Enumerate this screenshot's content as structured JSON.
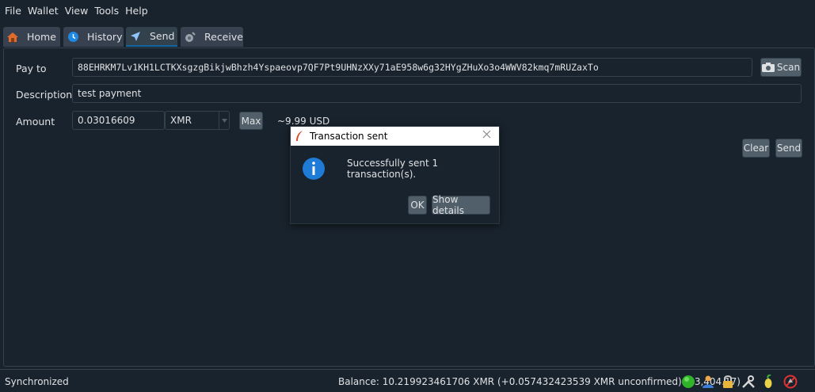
{
  "menu": [
    "File",
    "Wallet",
    "View",
    "Tools",
    "Help"
  ],
  "tabs": [
    {
      "label": "Home",
      "icon": "home-icon",
      "active": false
    },
    {
      "label": "History",
      "icon": "history-icon",
      "active": false
    },
    {
      "label": "Send",
      "icon": "send-icon",
      "active": true
    },
    {
      "label": "Receive",
      "icon": "receive-icon",
      "active": false
    }
  ],
  "send": {
    "pay_to_label": "Pay to",
    "pay_to_value": "88EHRKM7Lv1KH1LCTKXsgzgBikjwBhzh4Yspaeovp7QF7Pt9UHNzXXy71aE958w6g32HYgZHuXo3o4WWV82kmq7mRUZaxTo",
    "scan_label": "Scan",
    "description_label": "Description",
    "description_value": "test payment",
    "amount_label": "Amount",
    "amount_value": "0.03016609",
    "currency": "XMR",
    "max_label": "Max",
    "fiat_estimate": "~9.99 USD",
    "clear_label": "Clear",
    "send_label": "Send"
  },
  "dialog": {
    "title": "Transaction sent",
    "message": "Successfully sent 1 transaction(s).",
    "ok_label": "OK",
    "details_label": "Show details"
  },
  "status": {
    "sync_text": "Synchronized",
    "balance_text": "Balance: 10.219923461706 XMR (+0.057432423539 XMR unconfirmed) ($3,404.17)"
  },
  "colors": {
    "background": "#19232d",
    "accent": "#1464a0",
    "button": "#505f69",
    "status_ok": "#2fb42a"
  }
}
